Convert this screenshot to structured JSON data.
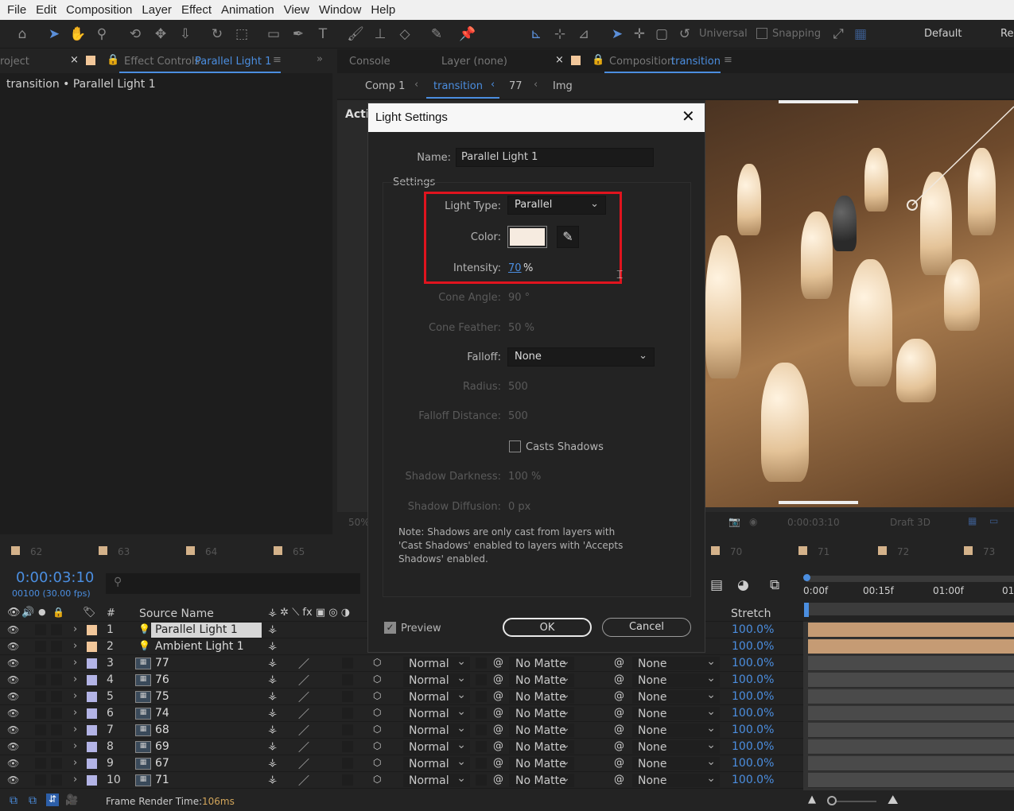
{
  "menu": [
    "File",
    "Edit",
    "Composition",
    "Layer",
    "Effect",
    "Animation",
    "View",
    "Window",
    "Help"
  ],
  "toolbar": {
    "universal": "Universal",
    "snapping": "Snapping",
    "workspace": "Default",
    "workspace2": "Re"
  },
  "left_panel": {
    "tab_project": "roject",
    "tab_effect_prefix": "Effect Controls",
    "tab_effect_name": "Parallel Light 1",
    "header": "transition • Parallel Light 1"
  },
  "comp_panel": {
    "tab_console": "Console",
    "tab_layer": "Layer (none)",
    "tab_comp_prefix": "Composition",
    "tab_comp_name": "transition",
    "crumbs": [
      "Comp 1",
      "transition",
      "77",
      "Img"
    ],
    "active_label": "Activ",
    "zoom": "50%",
    "timecode": "0:00:03:10",
    "draft": "Draft 3D"
  },
  "timeline_markers": [
    "62",
    "63",
    "64",
    "65",
    "70",
    "71",
    "72",
    "73"
  ],
  "timeline": {
    "timecode": "0:00:03:10",
    "frames": "00100 (30.00 fps)",
    "search_icon": "search-icon",
    "col_num": "#",
    "col_source": "Source Name",
    "col_stretch": "Stretch",
    "ruler": [
      "0:00f",
      "00:15f",
      "01:00f",
      "01"
    ],
    "frame_render_label": "Frame Render Time:",
    "frame_render_value": "106ms"
  },
  "layers": [
    {
      "num": "1",
      "name": "Parallel Light 1",
      "color": "#f2c79a",
      "type": "light",
      "stretch": "100.0%"
    },
    {
      "num": "2",
      "name": "Ambient Light 1",
      "color": "#f2c79a",
      "type": "light",
      "stretch": "100.0%"
    },
    {
      "num": "3",
      "name": "77",
      "color": "#b3b4e6",
      "type": "image",
      "mode": "Normal",
      "matte": "No Matte",
      "parent": "None",
      "stretch": "100.0%"
    },
    {
      "num": "4",
      "name": "76",
      "color": "#b3b4e6",
      "type": "image",
      "mode": "Normal",
      "matte": "No Matte",
      "parent": "None",
      "stretch": "100.0%"
    },
    {
      "num": "5",
      "name": "75",
      "color": "#b3b4e6",
      "type": "image",
      "mode": "Normal",
      "matte": "No Matte",
      "parent": "None",
      "stretch": "100.0%"
    },
    {
      "num": "6",
      "name": "74",
      "color": "#b3b4e6",
      "type": "image",
      "mode": "Normal",
      "matte": "No Matte",
      "parent": "None",
      "stretch": "100.0%"
    },
    {
      "num": "7",
      "name": "68",
      "color": "#b3b4e6",
      "type": "image",
      "mode": "Normal",
      "matte": "No Matte",
      "parent": "None",
      "stretch": "100.0%"
    },
    {
      "num": "8",
      "name": "69",
      "color": "#b3b4e6",
      "type": "image",
      "mode": "Normal",
      "matte": "No Matte",
      "parent": "None",
      "stretch": "100.0%"
    },
    {
      "num": "9",
      "name": "67",
      "color": "#b3b4e6",
      "type": "image",
      "mode": "Normal",
      "matte": "No Matte",
      "parent": "None",
      "stretch": "100.0%"
    },
    {
      "num": "10",
      "name": "71",
      "color": "#b3b4e6",
      "type": "image",
      "mode": "Normal",
      "matte": "No Matte",
      "parent": "None",
      "stretch": "100.0%"
    }
  ],
  "dialog": {
    "title": "Light Settings",
    "name_label": "Name:",
    "name_value": "Parallel Light 1",
    "settings_label": "Settings",
    "light_type_label": "Light Type:",
    "light_type_value": "Parallel",
    "color_label": "Color:",
    "color_value": "#f6ebe0",
    "intensity_label": "Intensity:",
    "intensity_value": "70",
    "intensity_unit": "%",
    "cone_angle_label": "Cone Angle:",
    "cone_angle_value": "90 °",
    "cone_feather_label": "Cone Feather:",
    "cone_feather_value": "50 %",
    "falloff_label": "Falloff:",
    "falloff_value": "None",
    "radius_label": "Radius:",
    "radius_value": "500",
    "falloff_distance_label": "Falloff Distance:",
    "falloff_distance_value": "500",
    "casts_shadows_label": "Casts Shadows",
    "shadow_darkness_label": "Shadow Darkness:",
    "shadow_darkness_value": "100 %",
    "shadow_diffusion_label": "Shadow Diffusion:",
    "shadow_diffusion_value": "0 px",
    "note": "Note: Shadows are only cast from layers with 'Cast Shadows' enabled to layers with 'Accepts Shadows' enabled.",
    "preview_label": "Preview",
    "ok_label": "OK",
    "cancel_label": "Cancel",
    "highlight_color": "#e0141e"
  }
}
